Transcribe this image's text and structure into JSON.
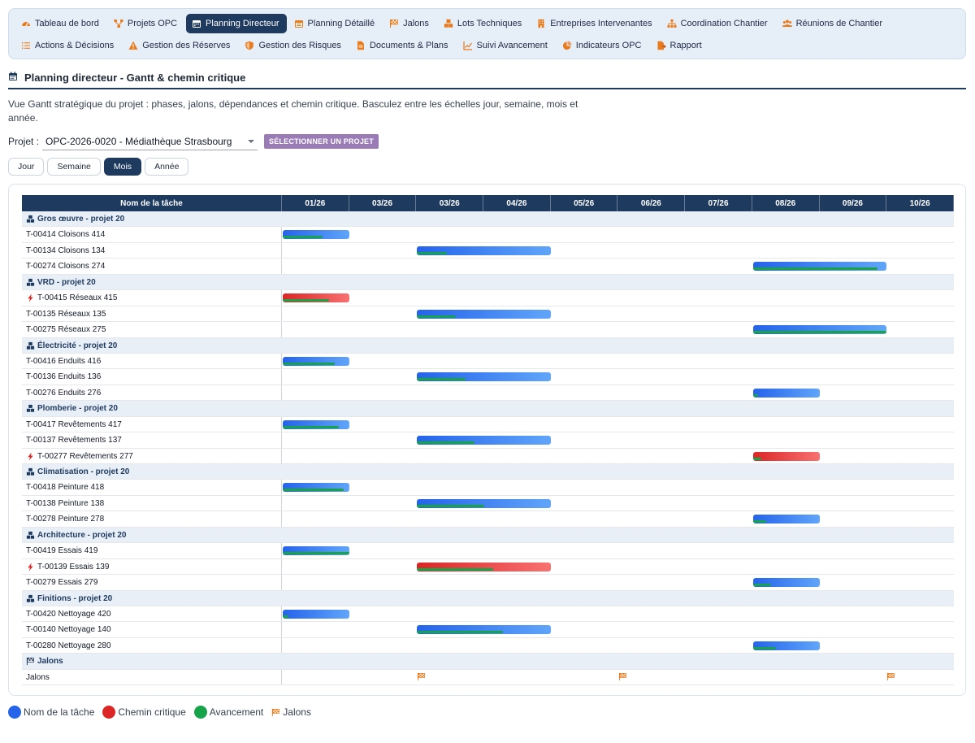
{
  "nav": {
    "row1": [
      {
        "label": "Tableau de bord",
        "icon": "gauge-icon",
        "active": false
      },
      {
        "label": "Projets OPC",
        "icon": "sitemap-icon",
        "active": false
      },
      {
        "label": "Planning Directeur",
        "icon": "calendar-icon",
        "active": true
      },
      {
        "label": "Planning Détaillé",
        "icon": "calendar-list-icon",
        "active": false
      },
      {
        "label": "Jalons",
        "icon": "flag-checkered-icon",
        "active": false
      },
      {
        "label": "Lots Techniques",
        "icon": "cubes-icon",
        "active": false
      },
      {
        "label": "Entreprises Intervenantes",
        "icon": "building-icon",
        "active": false
      },
      {
        "label": "Coordination Chantier",
        "icon": "hierarchy-icon",
        "active": false
      },
      {
        "label": "Réunions de Chantier",
        "icon": "users-icon",
        "active": false
      }
    ],
    "row2": [
      {
        "label": "Actions & Décisions",
        "icon": "list-icon",
        "active": false
      },
      {
        "label": "Gestion des Réserves",
        "icon": "warning-icon",
        "active": false
      },
      {
        "label": "Gestion des Risques",
        "icon": "shield-icon",
        "active": false
      },
      {
        "label": "Documents & Plans",
        "icon": "file-icon",
        "active": false
      },
      {
        "label": "Suivi Avancement",
        "icon": "chart-line-icon",
        "active": false
      },
      {
        "label": "Indicateurs OPC",
        "icon": "chart-pie-icon",
        "active": false
      },
      {
        "label": "Rapport",
        "icon": "file-export-icon",
        "active": false
      }
    ]
  },
  "page": {
    "title": "Planning directeur - Gantt & chemin critique",
    "description": "Vue Gantt stratégique du projet : phases, jalons, dépendances et chemin critique. Basculez entre les échelles jour, semaine, mois et année.",
    "project_label": "Projet :",
    "project_value": "OPC-2026-0020 - Médiathèque Strasbourg",
    "select_button": "SÉLECTIONNER UN PROJET",
    "scales": [
      "Jour",
      "Semaine",
      "Mois",
      "Année"
    ],
    "active_scale": "Mois"
  },
  "gantt": {
    "name_header": "Nom de la tâche",
    "columns": [
      "01/26",
      "03/26",
      "03/26",
      "04/26",
      "05/26",
      "06/26",
      "07/26",
      "08/26",
      "09/26",
      "10/26"
    ],
    "groups": [
      {
        "name": "Gros œuvre - projet 20",
        "tasks": [
          {
            "name": "T-00414 Cloisons 414",
            "start": 0,
            "span": 1,
            "progress": 0.6,
            "critical": false
          },
          {
            "name": "T-00134 Cloisons 134",
            "start": 2,
            "span": 2,
            "progress": 0.22,
            "critical": false
          },
          {
            "name": "T-00274 Cloisons 274",
            "start": 7,
            "span": 2,
            "progress": 0.93,
            "critical": false
          }
        ]
      },
      {
        "name": "VRD - projet 20",
        "tasks": [
          {
            "name": "T-00415 Réseaux 415",
            "start": 0,
            "span": 1,
            "progress": 0.7,
            "critical": true
          },
          {
            "name": "T-00135 Réseaux 135",
            "start": 2,
            "span": 2,
            "progress": 0.29,
            "critical": false
          },
          {
            "name": "T-00275 Réseaux 275",
            "start": 7,
            "span": 2,
            "progress": 1.0,
            "critical": false
          }
        ]
      },
      {
        "name": "Électricité - projet 20",
        "tasks": [
          {
            "name": "T-00416 Enduits 416",
            "start": 0,
            "span": 1,
            "progress": 0.78,
            "critical": false
          },
          {
            "name": "T-00136 Enduits 136",
            "start": 2,
            "span": 2,
            "progress": 0.36,
            "critical": false
          },
          {
            "name": "T-00276 Enduits 276",
            "start": 7,
            "span": 1,
            "progress": 0.08,
            "critical": false
          }
        ]
      },
      {
        "name": "Plomberie - projet 20",
        "tasks": [
          {
            "name": "T-00417 Revêtements 417",
            "start": 0,
            "span": 1,
            "progress": 0.84,
            "critical": false
          },
          {
            "name": "T-00137 Revêtements 137",
            "start": 2,
            "span": 2,
            "progress": 0.43,
            "critical": false
          },
          {
            "name": "T-00277 Revêtements 277",
            "start": 7,
            "span": 1,
            "progress": 0.12,
            "critical": true
          }
        ]
      },
      {
        "name": "Climatisation - projet 20",
        "tasks": [
          {
            "name": "T-00418 Peinture 418",
            "start": 0,
            "span": 1,
            "progress": 0.92,
            "critical": false
          },
          {
            "name": "T-00138 Peinture 138",
            "start": 2,
            "span": 2,
            "progress": 0.5,
            "critical": false
          },
          {
            "name": "T-00278 Peinture 278",
            "start": 7,
            "span": 1,
            "progress": 0.2,
            "critical": false
          }
        ]
      },
      {
        "name": "Architecture - projet 20",
        "tasks": [
          {
            "name": "T-00419 Essais 419",
            "start": 0,
            "span": 1,
            "progress": 1.0,
            "critical": false
          },
          {
            "name": "T-00139 Essais 139",
            "start": 2,
            "span": 2,
            "progress": 0.57,
            "critical": true
          },
          {
            "name": "T-00279 Essais 279",
            "start": 7,
            "span": 1,
            "progress": 0.27,
            "critical": false
          }
        ]
      },
      {
        "name": "Finitions - projet 20",
        "tasks": [
          {
            "name": "T-00420 Nettoyage 420",
            "start": 0,
            "span": 1,
            "progress": 0.08,
            "critical": false
          },
          {
            "name": "T-00140 Nettoyage 140",
            "start": 2,
            "span": 2,
            "progress": 0.64,
            "critical": false
          },
          {
            "name": "T-00280 Nettoyage 280",
            "start": 7,
            "span": 1,
            "progress": 0.34,
            "critical": false
          }
        ]
      }
    ],
    "milestones_group": "Jalons",
    "milestones_row": "Jalons",
    "milestones": [
      2.05,
      5.05,
      9.05
    ]
  },
  "legend": [
    {
      "label": "Nom de la tâche",
      "color": "#2563eb",
      "kind": "dot"
    },
    {
      "label": "Chemin critique",
      "color": "#dc2626",
      "kind": "dot"
    },
    {
      "label": "Avancement",
      "color": "#16a34a",
      "kind": "dot"
    },
    {
      "label": "Jalons",
      "color": "#ea7b1c",
      "kind": "flag"
    }
  ],
  "colors": {
    "primary": "#1e3a5f",
    "bar": "#2563eb",
    "critical": "#dc2626",
    "progress": "#16a34a",
    "accent_orange": "#ea7b1c",
    "select_button": "#9a7bb5"
  }
}
